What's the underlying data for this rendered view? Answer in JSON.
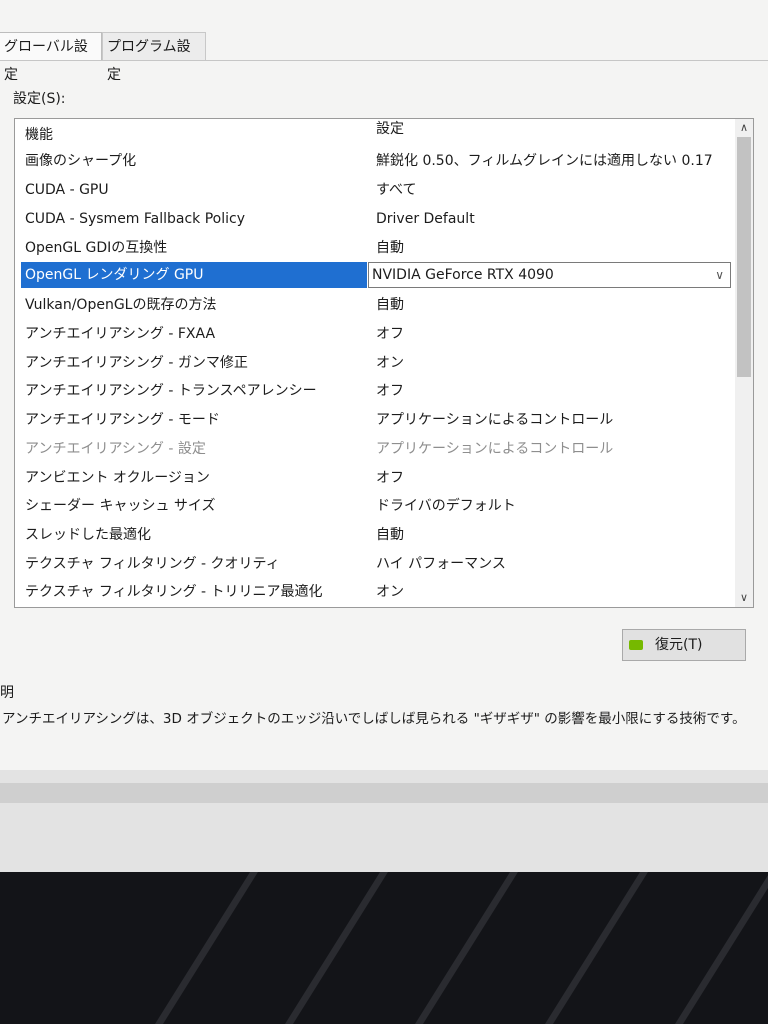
{
  "tabs": {
    "global": "グローバル設定",
    "program": "プログラム設定"
  },
  "settings_label": "設定(S):",
  "table": {
    "header": {
      "feature": "機能",
      "setting": "設定"
    },
    "rows": [
      {
        "feature": "画像のシャープ化",
        "setting": "鮮鋭化 0.50、フィルムグレインには適用しない 0.17"
      },
      {
        "feature": "CUDA - GPU",
        "setting": "すべて"
      },
      {
        "feature": "CUDA - Sysmem Fallback Policy",
        "setting": "Driver Default"
      },
      {
        "feature": "OpenGL GDIの互換性",
        "setting": "自動"
      },
      {
        "feature": "OpenGL レンダリング GPU",
        "setting": "NVIDIA GeForce RTX 4090"
      },
      {
        "feature": "Vulkan/OpenGLの既存の方法",
        "setting": "自動"
      },
      {
        "feature": "アンチエイリアシング - FXAA",
        "setting": "オフ"
      },
      {
        "feature": "アンチエイリアシング - ガンマ修正",
        "setting": "オン"
      },
      {
        "feature": "アンチエイリアシング - トランスペアレンシー",
        "setting": "オフ"
      },
      {
        "feature": "アンチエイリアシング - モード",
        "setting": "アプリケーションによるコントロール"
      },
      {
        "feature": "アンチエイリアシング - 設定",
        "setting": "アプリケーションによるコントロール"
      },
      {
        "feature": "アンビエント オクルージョン",
        "setting": "オフ"
      },
      {
        "feature": "シェーダー キャッシュ サイズ",
        "setting": "ドライバのデフォルト"
      },
      {
        "feature": "スレッドした最適化",
        "setting": "自動"
      },
      {
        "feature": "テクスチャ フィルタリング - クオリティ",
        "setting": "ハイ パフォーマンス"
      },
      {
        "feature": "テクスチャ フィルタリング - トリリニア最適化",
        "setting": "オン"
      }
    ]
  },
  "restore_button": "復元(T)",
  "description": {
    "heading": "明",
    "text": "アンチエイリアシングは、3D オブジェクトのエッジ沿いでしばしば見られる \"ギザギザ\" の影響を最小限にする技術です。"
  },
  "colors": {
    "selection": "#1f6fd1",
    "nvidia_green": "#76b900"
  }
}
